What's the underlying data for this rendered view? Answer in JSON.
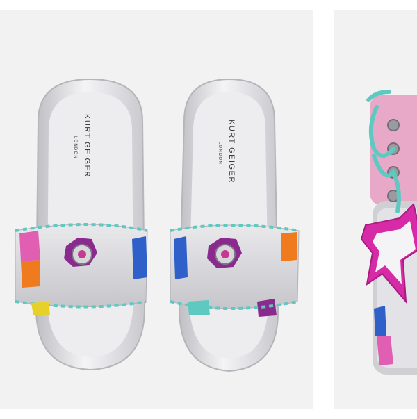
{
  "products": [
    {
      "name": "product-image-slides",
      "brand": "KURT GEIGER",
      "brand_sub": "LONDON",
      "colors": {
        "silver": "#d9d9dc",
        "teal": "#5ec9c1",
        "purple": "#8a2a8f",
        "pink": "#e05fb3",
        "orange": "#f07a1e",
        "blue": "#2f5fc9"
      }
    },
    {
      "name": "product-image-sneaker",
      "colors": {
        "pink": "#e8a9c9",
        "magenta": "#d62aa6",
        "teal": "#5ec9c1",
        "silver": "#cfcfd4"
      }
    }
  ]
}
